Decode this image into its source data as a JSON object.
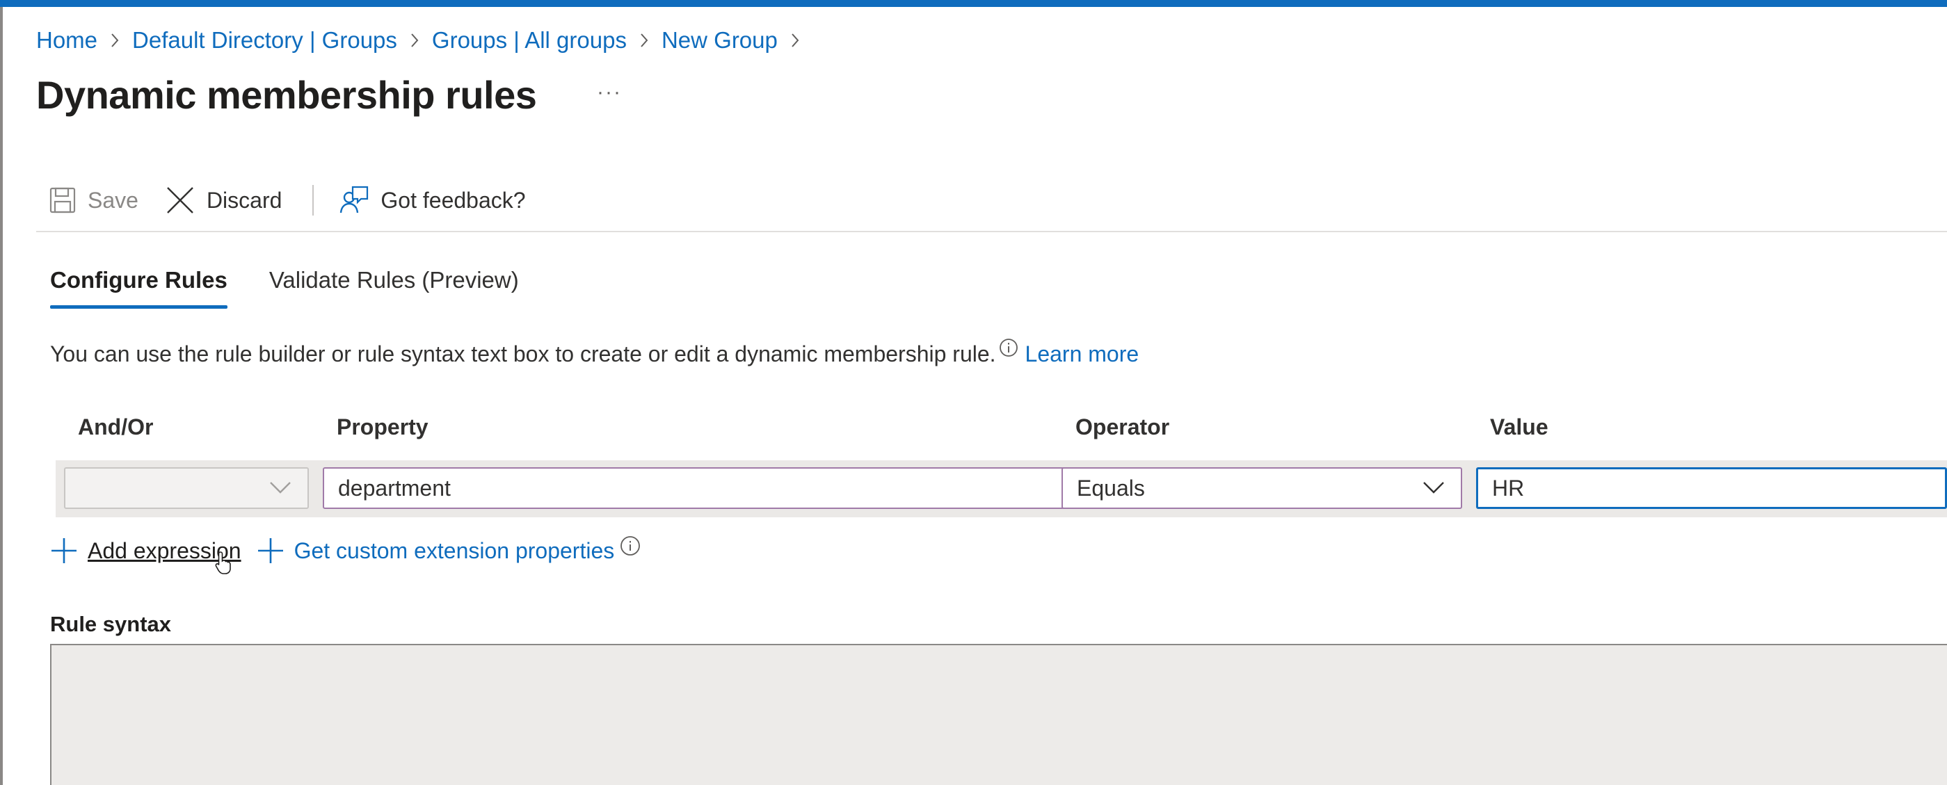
{
  "breadcrumb": [
    "Home",
    "Default Directory | Groups",
    "Groups | All groups",
    "New Group"
  ],
  "page": {
    "title": "Dynamic membership rules",
    "more": "···"
  },
  "toolbar": {
    "save": "Save",
    "discard": "Discard",
    "feedback": "Got feedback?"
  },
  "tabs": [
    "Configure Rules",
    "Validate Rules (Preview)"
  ],
  "active_tab": "Configure Rules",
  "description": {
    "text": "You can use the rule builder or rule syntax text box to create or edit a dynamic membership rule.",
    "link": "Learn more"
  },
  "rule_builder": {
    "columns": [
      "And/Or",
      "Property",
      "Operator",
      "Value"
    ],
    "row": {
      "and_or": "",
      "property": "department",
      "operator": "Equals",
      "value": "HR"
    }
  },
  "actions": {
    "add_expression": "Add expression",
    "custom_extension": "Get custom extension properties"
  },
  "rule_syntax": {
    "label": "Rule syntax",
    "value": ""
  },
  "colors": {
    "accent": "#0f6cbd",
    "row_bg": "#ebe9e7",
    "syntax_bg": "#edebe9"
  }
}
